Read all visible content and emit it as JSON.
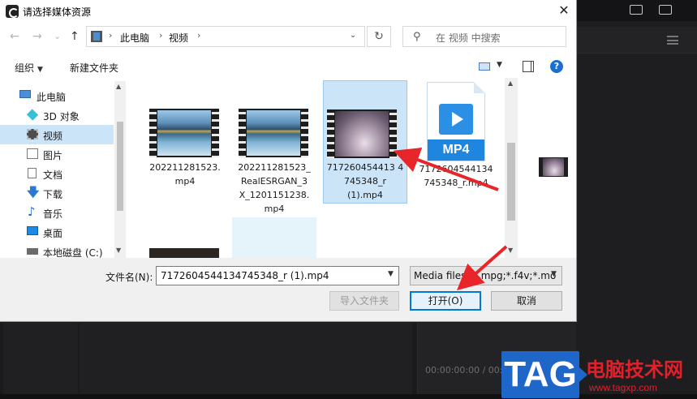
{
  "dialog": {
    "title": "请选择媒体资源",
    "close_label": "✕"
  },
  "nav": {
    "back": "←",
    "forward": "→",
    "recent": "⌄",
    "up": "↑",
    "breadcrumb": [
      "此电脑",
      "视频"
    ],
    "separator": "›",
    "dropdown": "⌄",
    "refresh": "↻",
    "search_icon": "⚲",
    "search_placeholder": "在 视频 中搜索"
  },
  "toolbar": {
    "organize": "组织",
    "new_folder": "新建文件夹",
    "help": "?"
  },
  "sidebar": {
    "items": [
      {
        "label": "此电脑",
        "icon": "computer-icon"
      },
      {
        "label": "3D 对象",
        "icon": "3d-objects-icon"
      },
      {
        "label": "视频",
        "icon": "video-folder-icon",
        "selected": true
      },
      {
        "label": "图片",
        "icon": "pictures-icon"
      },
      {
        "label": "文档",
        "icon": "documents-icon"
      },
      {
        "label": "下载",
        "icon": "download-icon"
      },
      {
        "label": "音乐",
        "icon": "music-icon"
      },
      {
        "label": "桌面",
        "icon": "desktop-icon"
      },
      {
        "label": "本地磁盘 (C:)",
        "icon": "disk-icon"
      }
    ],
    "download_glyph": "🡇",
    "music_glyph": "♪"
  },
  "files": [
    {
      "name": "202211281523.\nmp4",
      "thumb": "lake"
    },
    {
      "name": "202211281523_\nRealESRGAN_3\nX_1201151238.\nmp4",
      "thumb": "lake"
    },
    {
      "name": "717260454413 4\n745348_r\n(1).mp4",
      "thumb": "purple",
      "selected": true
    },
    {
      "name": "7172604544134\n745348_r.mp4",
      "thumb": "mp4-doc"
    }
  ],
  "mp4_badge": "MP4",
  "form": {
    "filename_label": "文件名(N):",
    "filename_value": "7172604544134745348_r (1).mp4",
    "filetype_value": "Media files (*.mpg;*.f4v;*.mo",
    "import_folder": "导入文件夹",
    "open": "打开(O)",
    "cancel": "取消"
  },
  "background_app": {
    "timecode": "00:00:00:00 / 00:0"
  },
  "watermark": {
    "tag": "TAG",
    "site_name": "电脑技术网",
    "url": "www.tagxp.com"
  },
  "colors": {
    "selection": "#cce4f7",
    "accent": "#0078d7",
    "annotation_arrow": "#e8262a"
  }
}
